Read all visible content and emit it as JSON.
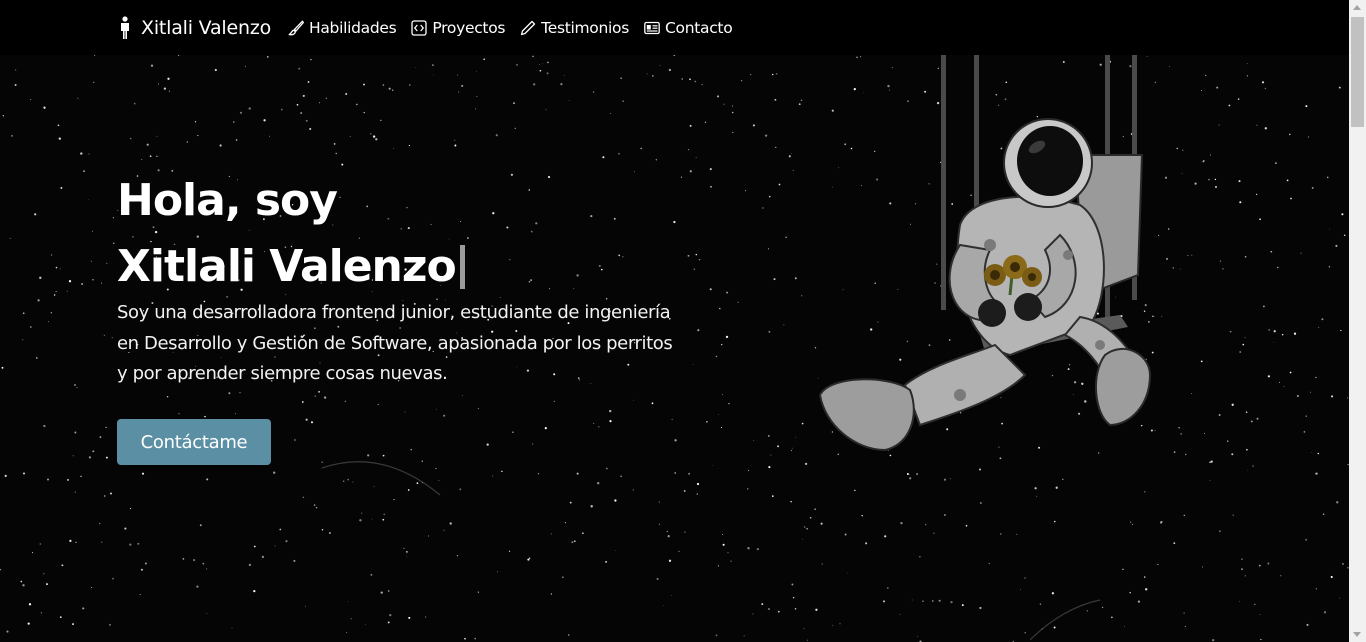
{
  "nav": {
    "brand": {
      "icon": "person-standing-icon",
      "name": "Xitlali Valenzo"
    },
    "links": [
      {
        "label": "Habilidades",
        "icon": "brush-icon"
      },
      {
        "label": "Proyectos",
        "icon": "code-square-icon"
      },
      {
        "label": "Testimonios",
        "icon": "pencil-icon"
      },
      {
        "label": "Contacto",
        "icon": "id-card-icon"
      }
    ]
  },
  "hero": {
    "greeting": "Hola, soy",
    "name": "Xitlali Valenzo",
    "description": "Soy una desarrolladora frontend junior, estudiante de ingeniería en Desarrollo y Gestión de Software, apasionada por los perritos y por aprender siempre cosas nuevas.",
    "cta_label": "Contáctame",
    "cta_color": "#5a8fa4",
    "illustration": "astronaut-on-swing-illustration"
  },
  "colors": {
    "background": "#000000",
    "text": "#ffffff",
    "button": "#5a8fa4"
  }
}
